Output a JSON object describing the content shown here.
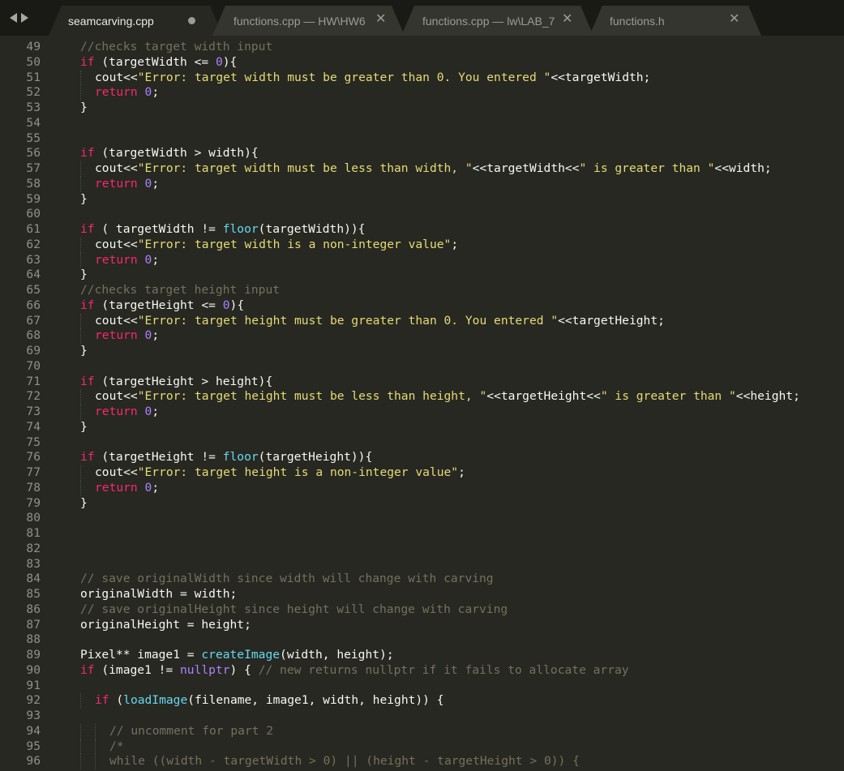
{
  "colors": {
    "background": "#272822",
    "tabbar": "#191a16",
    "keyword": "#f92672",
    "string": "#e6db74",
    "number": "#ae81ff",
    "function": "#66d9ef",
    "comment": "#75715e",
    "plain": "#f8f8f2",
    "gutter": "#90908a"
  },
  "tabs": [
    {
      "label": "seamcarving.cpp",
      "active": true,
      "modified": true
    },
    {
      "label": "functions.cpp — HW\\HW6",
      "active": false,
      "modified": false
    },
    {
      "label": "functions.cpp — lw\\LAB_7",
      "active": false,
      "modified": false
    },
    {
      "label": "functions.h",
      "active": false,
      "modified": false
    }
  ],
  "icons": {
    "back": "arrow-left-icon",
    "forward": "arrow-right-icon",
    "close": "close-icon",
    "modified": "unsaved-dot-icon"
  },
  "close_glyph": "✕",
  "lines": [
    {
      "n": "49",
      "indent": 1,
      "tokens": [
        [
          "cm",
          "//checks target width input"
        ]
      ]
    },
    {
      "n": "50",
      "indent": 1,
      "tokens": [
        [
          "kw",
          "if"
        ],
        [
          "pl",
          " (targetWidth <= "
        ],
        [
          "num",
          "0"
        ],
        [
          "pl",
          "){"
        ]
      ]
    },
    {
      "n": "51",
      "indent": 2,
      "tokens": [
        [
          "pl",
          "cout<<"
        ],
        [
          "str",
          "\"Error: target width must be greater than 0. You entered \""
        ],
        [
          "pl",
          "<<targetWidth;"
        ]
      ]
    },
    {
      "n": "52",
      "indent": 2,
      "tokens": [
        [
          "kw",
          "return"
        ],
        [
          "pl",
          " "
        ],
        [
          "num",
          "0"
        ],
        [
          "pl",
          ";"
        ]
      ]
    },
    {
      "n": "53",
      "indent": 1,
      "tokens": [
        [
          "pl",
          "}"
        ]
      ]
    },
    {
      "n": "54",
      "indent": 0,
      "tokens": []
    },
    {
      "n": "55",
      "indent": 0,
      "tokens": []
    },
    {
      "n": "56",
      "indent": 1,
      "tokens": [
        [
          "kw",
          "if"
        ],
        [
          "pl",
          " (targetWidth > width){"
        ]
      ]
    },
    {
      "n": "57",
      "indent": 2,
      "tokens": [
        [
          "pl",
          "cout<<"
        ],
        [
          "str",
          "\"Error: target width must be less than width, \""
        ],
        [
          "pl",
          "<<targetWidth<<"
        ],
        [
          "str",
          "\" is greater than \""
        ],
        [
          "pl",
          "<<width;"
        ]
      ]
    },
    {
      "n": "58",
      "indent": 2,
      "tokens": [
        [
          "kw",
          "return"
        ],
        [
          "pl",
          " "
        ],
        [
          "num",
          "0"
        ],
        [
          "pl",
          ";"
        ]
      ]
    },
    {
      "n": "59",
      "indent": 1,
      "tokens": [
        [
          "pl",
          "}"
        ]
      ]
    },
    {
      "n": "60",
      "indent": 0,
      "tokens": []
    },
    {
      "n": "61",
      "indent": 1,
      "tokens": [
        [
          "kw",
          "if"
        ],
        [
          "pl",
          " ( targetWidth != "
        ],
        [
          "fn",
          "floor"
        ],
        [
          "pl",
          "(targetWidth)){"
        ]
      ]
    },
    {
      "n": "62",
      "indent": 2,
      "tokens": [
        [
          "pl",
          "cout<<"
        ],
        [
          "str",
          "\"Error: target width is a non-integer value\""
        ],
        [
          "pl",
          ";"
        ]
      ]
    },
    {
      "n": "63",
      "indent": 2,
      "tokens": [
        [
          "kw",
          "return"
        ],
        [
          "pl",
          " "
        ],
        [
          "num",
          "0"
        ],
        [
          "pl",
          ";"
        ]
      ]
    },
    {
      "n": "64",
      "indent": 1,
      "tokens": [
        [
          "pl",
          "}"
        ]
      ]
    },
    {
      "n": "65",
      "indent": 1,
      "tokens": [
        [
          "cm",
          "//checks target height input"
        ]
      ]
    },
    {
      "n": "66",
      "indent": 1,
      "tokens": [
        [
          "kw",
          "if"
        ],
        [
          "pl",
          " (targetHeight <= "
        ],
        [
          "num",
          "0"
        ],
        [
          "pl",
          "){"
        ]
      ]
    },
    {
      "n": "67",
      "indent": 2,
      "tokens": [
        [
          "pl",
          "cout<<"
        ],
        [
          "str",
          "\"Error: target height must be greater than 0. You entered \""
        ],
        [
          "pl",
          "<<targetHeight;"
        ]
      ]
    },
    {
      "n": "68",
      "indent": 2,
      "tokens": [
        [
          "kw",
          "return"
        ],
        [
          "pl",
          " "
        ],
        [
          "num",
          "0"
        ],
        [
          "pl",
          ";"
        ]
      ]
    },
    {
      "n": "69",
      "indent": 1,
      "tokens": [
        [
          "pl",
          "}"
        ]
      ]
    },
    {
      "n": "70",
      "indent": 0,
      "tokens": []
    },
    {
      "n": "71",
      "indent": 1,
      "tokens": [
        [
          "kw",
          "if"
        ],
        [
          "pl",
          " (targetHeight > height){"
        ]
      ]
    },
    {
      "n": "72",
      "indent": 2,
      "tokens": [
        [
          "pl",
          "cout<<"
        ],
        [
          "str",
          "\"Error: target height must be less than height, \""
        ],
        [
          "pl",
          "<<targetHeight<<"
        ],
        [
          "str",
          "\" is greater than \""
        ],
        [
          "pl",
          "<<height;"
        ]
      ]
    },
    {
      "n": "73",
      "indent": 2,
      "tokens": [
        [
          "kw",
          "return"
        ],
        [
          "pl",
          " "
        ],
        [
          "num",
          "0"
        ],
        [
          "pl",
          ";"
        ]
      ]
    },
    {
      "n": "74",
      "indent": 1,
      "tokens": [
        [
          "pl",
          "}"
        ]
      ]
    },
    {
      "n": "75",
      "indent": 0,
      "tokens": []
    },
    {
      "n": "76",
      "indent": 1,
      "tokens": [
        [
          "kw",
          "if"
        ],
        [
          "pl",
          " (targetHeight != "
        ],
        [
          "fn",
          "floor"
        ],
        [
          "pl",
          "(targetHeight)){"
        ]
      ]
    },
    {
      "n": "77",
      "indent": 2,
      "tokens": [
        [
          "pl",
          "cout<<"
        ],
        [
          "str",
          "\"Error: target height is a non-integer value\""
        ],
        [
          "pl",
          ";"
        ]
      ]
    },
    {
      "n": "78",
      "indent": 2,
      "tokens": [
        [
          "kw",
          "return"
        ],
        [
          "pl",
          " "
        ],
        [
          "num",
          "0"
        ],
        [
          "pl",
          ";"
        ]
      ]
    },
    {
      "n": "79",
      "indent": 1,
      "tokens": [
        [
          "pl",
          "}"
        ]
      ]
    },
    {
      "n": "80",
      "indent": 0,
      "tokens": []
    },
    {
      "n": "81",
      "indent": 0,
      "tokens": []
    },
    {
      "n": "82",
      "indent": 0,
      "tokens": []
    },
    {
      "n": "83",
      "indent": 0,
      "tokens": []
    },
    {
      "n": "84",
      "indent": 1,
      "tokens": [
        [
          "cm",
          "// save originalWidth since width will change with carving"
        ]
      ]
    },
    {
      "n": "85",
      "indent": 1,
      "tokens": [
        [
          "pl",
          "originalWidth = width;"
        ]
      ]
    },
    {
      "n": "86",
      "indent": 1,
      "tokens": [
        [
          "cm",
          "// save originalHeight since height will change with carving"
        ]
      ]
    },
    {
      "n": "87",
      "indent": 1,
      "tokens": [
        [
          "pl",
          "originalHeight = height;"
        ]
      ]
    },
    {
      "n": "88",
      "indent": 0,
      "tokens": []
    },
    {
      "n": "89",
      "indent": 1,
      "tokens": [
        [
          "pl",
          "Pixel** image1 = "
        ],
        [
          "fn",
          "createImage"
        ],
        [
          "pl",
          "(width, height);"
        ]
      ]
    },
    {
      "n": "90",
      "indent": 1,
      "tokens": [
        [
          "kw",
          "if"
        ],
        [
          "pl",
          " (image1 != "
        ],
        [
          "num",
          "nullptr"
        ],
        [
          "pl",
          ") { "
        ],
        [
          "cm",
          "// new returns nullptr if it fails to allocate array"
        ]
      ]
    },
    {
      "n": "91",
      "indent": 0,
      "tokens": []
    },
    {
      "n": "92",
      "indent": 2,
      "tokens": [
        [
          "kw",
          "if"
        ],
        [
          "pl",
          " ("
        ],
        [
          "fn",
          "loadImage"
        ],
        [
          "pl",
          "(filename, image1, width, height)) {"
        ]
      ]
    },
    {
      "n": "93",
      "indent": 0,
      "tokens": []
    },
    {
      "n": "94",
      "indent": 3,
      "tokens": [
        [
          "cm",
          "// uncomment for part 2"
        ]
      ]
    },
    {
      "n": "95",
      "indent": 3,
      "tokens": [
        [
          "cm",
          "/*"
        ]
      ]
    },
    {
      "n": "96",
      "indent": 3,
      "tokens": [
        [
          "cm",
          "while ((width - targetWidth > 0) || (height - targetHeight > 0)) {"
        ]
      ]
    }
  ]
}
